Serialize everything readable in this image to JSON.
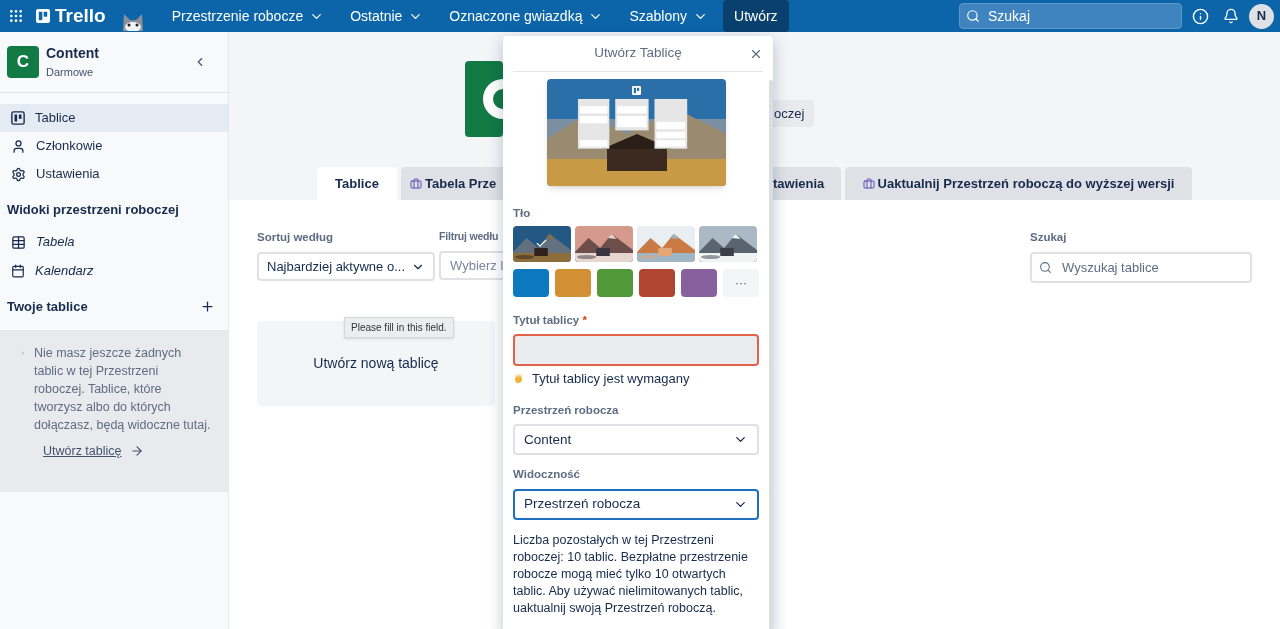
{
  "header": {
    "logo": "Trello",
    "nav": [
      {
        "label": "Przestrzenie robocze",
        "caret": true
      },
      {
        "label": "Ostatnie",
        "caret": true
      },
      {
        "label": "Oznaczone gwiazdką",
        "caret": true
      },
      {
        "label": "Szablony",
        "caret": true
      },
      {
        "label": "Utwórz",
        "caret": false
      }
    ],
    "search": {
      "placeholder": "Szukaj"
    },
    "avatar": "N"
  },
  "sidebar": {
    "workspace": {
      "initial": "C",
      "name": "Content",
      "plan": "Darmowe"
    },
    "nav": [
      {
        "label": "Tablice",
        "kind": "boards",
        "selected": true
      },
      {
        "label": "Członkowie",
        "kind": "members",
        "selected": false
      },
      {
        "label": "Ustawienia",
        "kind": "settings",
        "selected": false
      }
    ],
    "views_heading": "Widoki przestrzeni roboczej",
    "views": [
      {
        "label": "Tabela",
        "kind": "table"
      },
      {
        "label": "Kalendarz",
        "kind": "calendar"
      }
    ],
    "boards_heading": "Twoje tablice",
    "empty_text": "Nie masz jeszcze żadnych tablic w tej Przestrzeni roboczej. Tablice, które tworzysz albo do których dołączasz, będą widoczne tutaj.",
    "create_link": "Utwórz tablicę"
  },
  "main": {
    "header_button": "oczej",
    "tabs": [
      {
        "label": "Tablice",
        "selected": true,
        "icon": false
      },
      {
        "label": "Tabela Prze",
        "selected": false,
        "icon": true
      },
      {
        "label": "tawienia",
        "selected": false,
        "icon": false
      },
      {
        "label": "Uaktualnij Przestrzeń roboczą do wyższej wersji",
        "selected": false,
        "icon": true
      }
    ],
    "sort": {
      "label": "Sortuj według",
      "value": "Najbardziej aktywne o..."
    },
    "filter": {
      "label": "Filtruj wedłu",
      "placeholder": "Wybierz l"
    },
    "search": {
      "label": "Szukaj",
      "placeholder": "Wyszukaj tablice"
    },
    "create_card": "Utwórz nową tablicę",
    "tooltip": "Please fill in this field."
  },
  "popover": {
    "title": "Utwórz Tablicę",
    "background_label": "Tło",
    "photos": [
      {
        "selected": true
      },
      {
        "selected": false
      },
      {
        "selected": false
      },
      {
        "selected": false
      }
    ],
    "colors": [
      {
        "color": "#0c79bf",
        "selected": false
      },
      {
        "color": "#d29034",
        "selected": false
      },
      {
        "color": "#519839",
        "selected": false
      },
      {
        "color": "#b04632",
        "selected": false
      },
      {
        "color": "#89609e",
        "selected": false
      }
    ],
    "more": "···",
    "title_label": "Tytuł tablicy",
    "required_mark": "*",
    "title_error": "Tytuł tablicy jest wymagany",
    "workspace": {
      "label": "Przestrzeń robocza",
      "value": "Content"
    },
    "visibility": {
      "label": "Widoczność",
      "value": "Przestrzeń robocza"
    },
    "info": "Liczba pozostałych w tej Przestrzeni roboczej: 10 tablic. Bezpłatne przestrzenie robocze mogą mieć tylko 10 otwartych tablic. Aby używać nielimitowanych tablic, uaktualnij swoją Przestrzeń roboczą."
  }
}
